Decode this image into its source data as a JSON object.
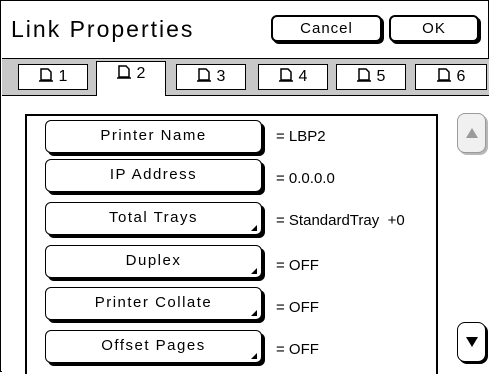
{
  "window": {
    "title": "Link Properties"
  },
  "header": {
    "cancel_label": "Cancel",
    "ok_label": "OK"
  },
  "tabs": [
    {
      "label": "1",
      "active": false
    },
    {
      "label": "2",
      "active": true
    },
    {
      "label": "3",
      "active": false
    },
    {
      "label": "4",
      "active": false
    },
    {
      "label": "5",
      "active": false
    },
    {
      "label": "6",
      "active": false
    }
  ],
  "rows": [
    {
      "label": "Printer Name",
      "value": "= LBP2",
      "has_submenu": false
    },
    {
      "label": "IP Address",
      "value": "= 0.0.0.0",
      "has_submenu": false
    },
    {
      "label": "Total Trays",
      "value": "= StandardTray  +0",
      "has_submenu": true
    },
    {
      "label": "Duplex",
      "value": "= OFF",
      "has_submenu": true
    },
    {
      "label": "Printer Collate",
      "value": "= OFF",
      "has_submenu": true
    },
    {
      "label": "Offset Pages",
      "value": "= OFF",
      "has_submenu": true
    }
  ],
  "scroll": {
    "up_enabled": false,
    "down_enabled": true
  },
  "icons": {
    "tab_icon": "page-icon",
    "scroll_up": "triangle-up-icon",
    "scroll_down": "triangle-down-icon"
  },
  "colors": {
    "tab_bar": "#c8c8c8",
    "disabled": "#9a9a9a"
  }
}
